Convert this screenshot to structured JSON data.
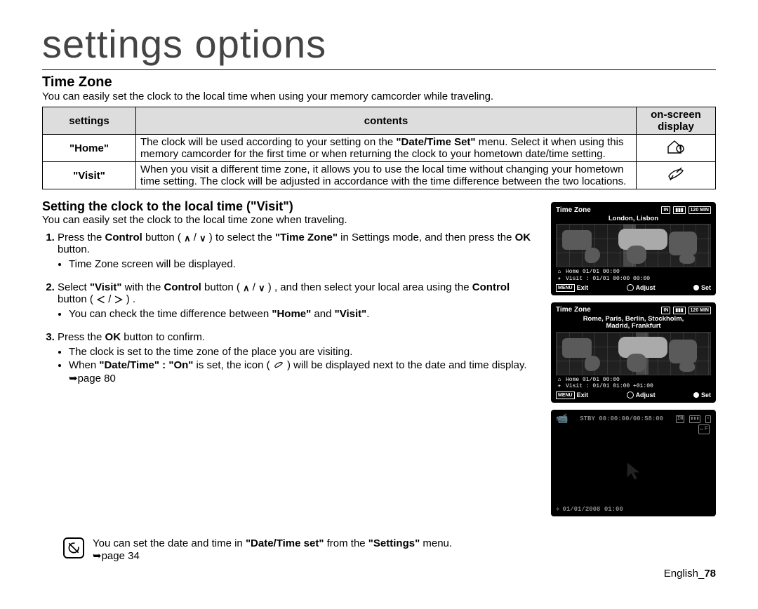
{
  "page": {
    "title": "settings options",
    "section_title": "Time Zone",
    "intro": "You can easily set the clock to the local time when using your memory camcorder while traveling.",
    "footer_lang": "English_",
    "footer_page": "78"
  },
  "table": {
    "head": {
      "c1": "settings",
      "c2": "contents",
      "c3": "on-screen display"
    },
    "rows": [
      {
        "setting": "\"Home\"",
        "contents_pre": "The clock will be used according to your setting on the ",
        "contents_bold": "\"Date/Time Set\"",
        "contents_post": " menu. Select it when using this memory camcorder for the first time or when returning the clock to your hometown date/time setting.",
        "icon": "home"
      },
      {
        "setting": "\"Visit\"",
        "contents": "When you visit a different time zone, it allows you to use the local time without changing your hometown time setting. The clock will be adjusted in accordance with the time difference between the two locations.",
        "icon": "plane"
      }
    ]
  },
  "subsection": {
    "title": "Setting the clock to the local time (\"Visit\")",
    "intro": "You can easily set the clock to the local time zone when traveling."
  },
  "steps": {
    "s1": {
      "pre": "Press the ",
      "b1": "Control",
      "mid1": " button ( ",
      "mid2": " / ",
      "mid3": " ) to select the ",
      "b2": "\"Time Zone\"",
      "post": " in Settings mode, and then press the ",
      "b3": "OK",
      "post2": " button.",
      "bullet1": "Time Zone screen will be displayed."
    },
    "s2": {
      "pre": "Select ",
      "b1": "\"Visit\"",
      "mid1": " with the ",
      "b2": "Control",
      "mid2": " button ( ",
      "mid3": " / ",
      "mid4": " ) , and then select your local area using the ",
      "b3": "Control",
      "mid5": " button ( ",
      "mid6": " / ",
      "mid7": " ) .",
      "bullet_pre": "You can check the time difference between ",
      "bullet_b1": "\"Home\"",
      "bullet_mid": " and ",
      "bullet_b2": "\"Visit\"",
      "bullet_post": "."
    },
    "s3": {
      "pre": "Press the ",
      "b1": "OK",
      "post": " button to confirm.",
      "bullet1": "The clock is set to the time zone of the place you are visiting.",
      "bullet2_pre": "When ",
      "bullet2_b1": "\"Date/Time\" : \"On\"",
      "bullet2_mid": " is set, the icon ( ",
      "bullet2_post": " ) will be displayed next to the date and time display. ",
      "bullet2_ref": "➥page 80"
    }
  },
  "note": {
    "pre": "You can set the date and time in ",
    "b1": "\"Date/Time set\"",
    "mid": " from the ",
    "b2": "\"Settings\"",
    "post": " menu.",
    "ref": "➥page 34"
  },
  "screens": {
    "s1": {
      "title": "Time Zone",
      "city": "London, Lisbon",
      "home": "Home  01/01 00:00",
      "visit": "Visit : 01/01 00:00 00:00",
      "status": {
        "a": "IN",
        "b": "▮▮▮",
        "c": "120 MIN"
      },
      "foot": {
        "exit": "Exit",
        "adjust": "Adjust",
        "set": "Set",
        "menu": "MENU"
      }
    },
    "s2": {
      "title": "Time Zone",
      "city1": "Rome, Paris, Berlin, Stockholm,",
      "city2": "Madrid, Frankfurt",
      "home": "Home  01/01 00:00",
      "visit": "Visit : 01/01 01:00 +01:00",
      "status": {
        "a": "IN",
        "b": "▮▮▮",
        "c": "120 MIN"
      },
      "foot": {
        "exit": "Exit",
        "adjust": "Adjust",
        "set": "Set",
        "menu": "MENU"
      }
    },
    "s3": {
      "stby": "STBY",
      "time": "00:00:00/00:58:00",
      "status": {
        "a": "IN",
        "b": "▮▮▮",
        "c": "⚡"
      },
      "face": "ᴗ F",
      "date": "01/01/2008 01:00"
    }
  }
}
